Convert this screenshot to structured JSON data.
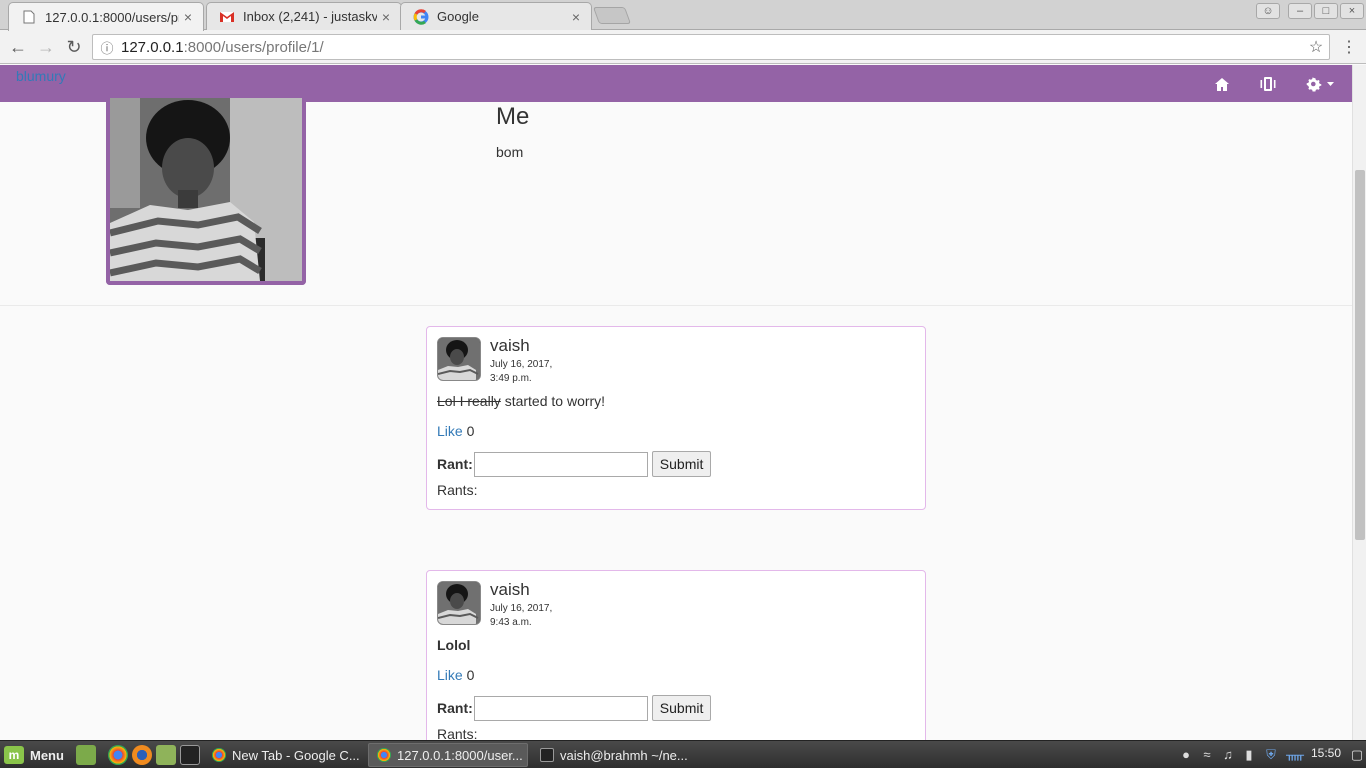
{
  "browser": {
    "tabs": [
      {
        "title": "127.0.0.1:8000/users/pr",
        "active": true,
        "favicon": "page-icon"
      },
      {
        "title": "Inbox (2,241) - justaskv",
        "active": false,
        "favicon": "gmail-icon"
      },
      {
        "title": "Google",
        "active": false,
        "favicon": "google-icon"
      }
    ],
    "close_glyph": "×",
    "url_host": "127.0.0.1",
    "url_path": ":8000/users/profile/1/"
  },
  "site": {
    "brand": "blumury",
    "nav_icons": [
      "home-icon",
      "vibrate-icon",
      "settings-icon"
    ]
  },
  "profile": {
    "name": "Me",
    "bio": "bom"
  },
  "posts": [
    {
      "author": "vaish",
      "date_line1": "July 16, 2017,",
      "date_line2": "3:49 p.m.",
      "body_struck": "Lol I really",
      "body_rest": " started to worry!",
      "like_label": "Like",
      "like_count": "0",
      "rant_label": "Rant:",
      "submit_label": "Submit",
      "rants_label": "Rants:"
    },
    {
      "author": "vaish",
      "date_line1": "July 16, 2017,",
      "date_line2": "9:43 a.m.",
      "body_bold": "Lolol",
      "like_label": "Like",
      "like_count": "0",
      "rant_label": "Rant:",
      "submit_label": "Submit",
      "rants_label": "Rants:"
    }
  ],
  "taskbar": {
    "menu_label": "Menu",
    "windows": [
      {
        "title": "New Tab - Google C...",
        "active": false
      },
      {
        "title": "127.0.0.1:8000/user...",
        "active": true
      },
      {
        "title": "vaish@brahmh ~/ne...",
        "active": false
      }
    ],
    "clock": "15:50"
  },
  "colors": {
    "nav_purple": "#9463a6",
    "link_blue": "#337ab7",
    "post_border": "#e3b8ea"
  }
}
